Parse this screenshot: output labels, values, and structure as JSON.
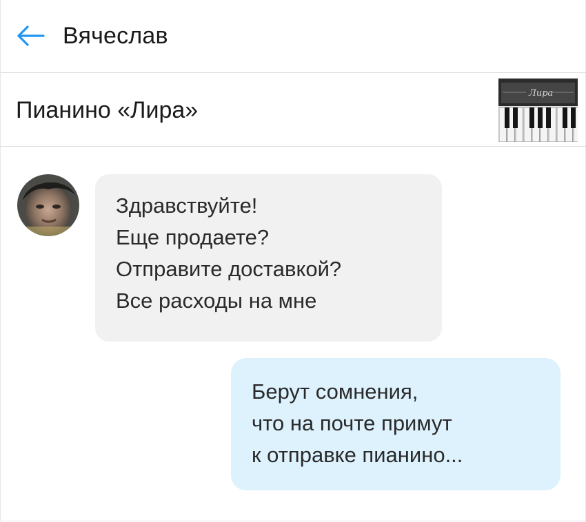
{
  "header": {
    "contact_name": "Вячеслав",
    "back_icon": "arrow-left-icon",
    "accent_color": "#2196f3"
  },
  "item": {
    "title": "Пианино «Лира»",
    "thumbnail_caption": "Лира"
  },
  "messages": [
    {
      "direction": "incoming",
      "lines": [
        "Здравствуйте!",
        "Еще продаете?",
        "Отправите доставкой?",
        "Все расходы на мне"
      ]
    },
    {
      "direction": "outgoing",
      "lines": [
        "Берут сомнения,",
        "что на почте примут",
        "к отправке пианино..."
      ]
    }
  ],
  "colors": {
    "incoming_bubble": "#f1f1f1",
    "outgoing_bubble": "#ddf2fd",
    "divider": "#dcdcdc"
  }
}
